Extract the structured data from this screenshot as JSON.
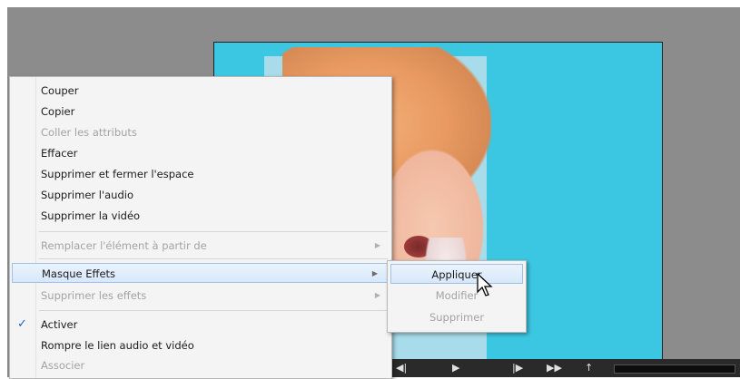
{
  "context_menu": {
    "items": [
      {
        "label": "Couper",
        "enabled": true
      },
      {
        "label": "Copier",
        "enabled": true
      },
      {
        "label": "Coller les attributs",
        "enabled": false
      },
      {
        "label": "Effacer",
        "enabled": true
      },
      {
        "label": "Supprimer et fermer l'espace",
        "enabled": true
      },
      {
        "label": "Supprimer l'audio",
        "enabled": true
      },
      {
        "label": "Supprimer la vidéo",
        "enabled": true
      },
      {
        "label": "Remplacer l'élément à partir de",
        "enabled": false,
        "submenu": true
      },
      {
        "label": "Masque Effets",
        "enabled": true,
        "submenu": true,
        "highlighted": true
      },
      {
        "label": "Supprimer les effets",
        "enabled": false,
        "submenu": true
      },
      {
        "label": "Activer",
        "enabled": true,
        "checked": true
      },
      {
        "label": "Rompre le lien audio et vidéo",
        "enabled": true
      },
      {
        "label": "Associer",
        "enabled": false
      }
    ]
  },
  "submenu": {
    "items": [
      {
        "label": "Appliquer",
        "enabled": true,
        "highlighted": true
      },
      {
        "label": "Modifier",
        "enabled": false
      },
      {
        "label": "Supprimer",
        "enabled": false
      }
    ]
  },
  "icons": {
    "check": "✓",
    "submenu_arrow": "▶",
    "transport": [
      "◀|",
      "▶",
      "|▶",
      "▶▶",
      "↑"
    ]
  },
  "colors": {
    "preview_background": "#3bc7e2",
    "highlight": "#d8e8fa",
    "disabled_text": "#a3a3a3",
    "check": "#1a63c9"
  }
}
